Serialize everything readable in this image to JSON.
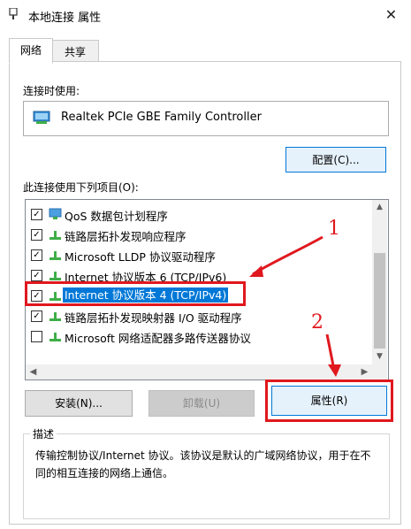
{
  "window": {
    "title": "本地连接 属性",
    "close": "✕"
  },
  "tabs": [
    {
      "label": "网络"
    },
    {
      "label": "共享"
    }
  ],
  "connect_using_label": "连接时使用:",
  "adapter_name": "Realtek PCIe GBE Family Controller",
  "configure_button": "配置(C)...",
  "items_label": "此连接使用下列项目(O):",
  "items": [
    {
      "label": "QoS 数据包计划程序",
      "checked": true
    },
    {
      "label": "链路层拓扑发现响应程序",
      "checked": true
    },
    {
      "label": "Microsoft LLDP 协议驱动程序",
      "checked": true
    },
    {
      "label": "Internet 协议版本 6 (TCP/IPv6)",
      "checked": true
    },
    {
      "label": "Internet 协议版本 4 (TCP/IPv4)",
      "checked": true,
      "selected": true
    },
    {
      "label": "链路层拓扑发现映射器 I/O 驱动程序",
      "checked": true
    },
    {
      "label": "Microsoft 网络适配器多路传送器协议",
      "checked": false
    }
  ],
  "install_button": "安装(N)...",
  "uninstall_button": "卸载(U)",
  "properties_button": "属性(R)",
  "description_title": "描述",
  "description_text": "传输控制协议/Internet 协议。该协议是默认的广域网络协议，用于在不同的相互连接的网络上通信。",
  "annotations": {
    "one": "1",
    "two": "2"
  },
  "colors": {
    "highlight": "#0078d7",
    "annotation": "#e0181e"
  }
}
